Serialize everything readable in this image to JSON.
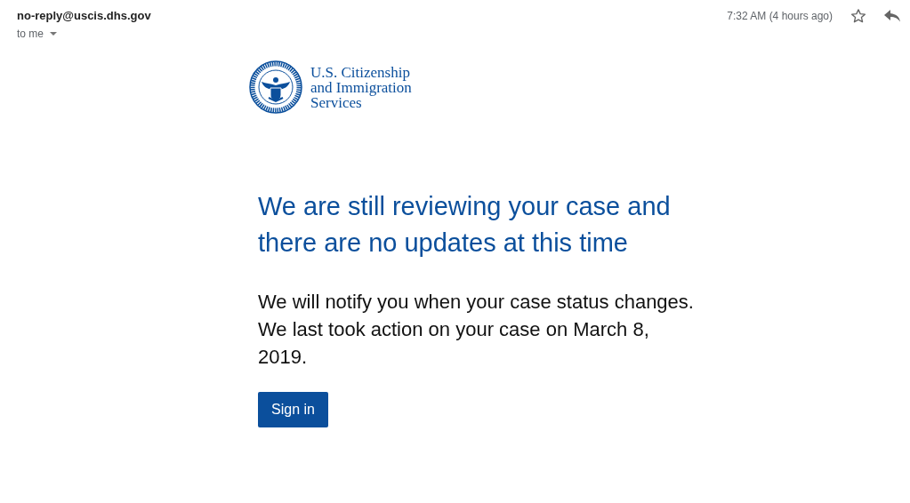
{
  "email_header": {
    "sender": "no-reply@uscis.dhs.gov",
    "recipient": "to me",
    "time": "7:32 AM (4 hours ago)",
    "starred": false
  },
  "logo": {
    "org_lines": [
      "U.S. Citizenship",
      "and Immigration",
      "Services"
    ]
  },
  "heading": "We are still reviewing your case and there are no updates at this time",
  "body": "We will notify you when your case status changes. We last took action on your case on March 8, 2019.",
  "button": "Sign in"
}
